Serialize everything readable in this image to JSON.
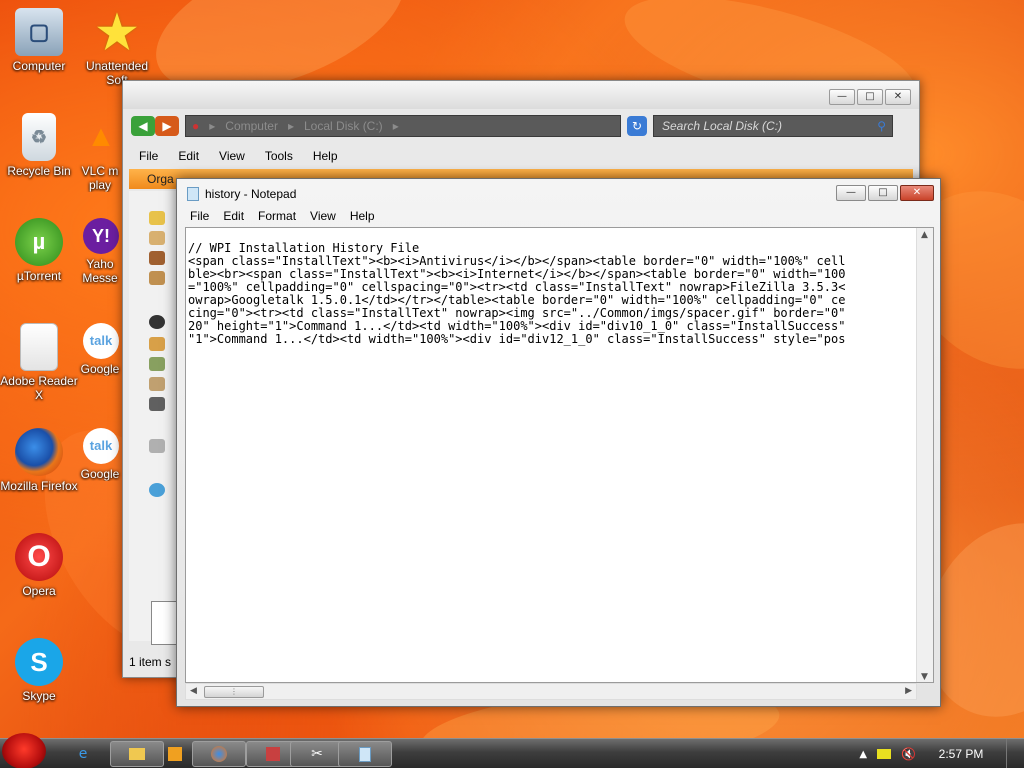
{
  "desktop": {
    "icons": [
      {
        "label": "Computer"
      },
      {
        "label": "Unattended Soft"
      },
      {
        "label": "Recycle Bin"
      },
      {
        "label": "VLC m play"
      },
      {
        "label": "µTorrent"
      },
      {
        "label": "Yaho Messe"
      },
      {
        "label": "Adobe Reader X"
      },
      {
        "label": "Google"
      },
      {
        "label": "Mozilla Firefox"
      },
      {
        "label": "Google"
      },
      {
        "label": "Opera"
      },
      {
        "label": "Skype"
      }
    ]
  },
  "explorer": {
    "address": [
      "Computer",
      "Local Disk (C:)"
    ],
    "search_placeholder": "Search Local Disk (C:)",
    "menu": [
      "File",
      "Edit",
      "View",
      "Tools",
      "Help"
    ],
    "org_label": "Orga",
    "status": "1 item s"
  },
  "notepad": {
    "title": "history - Notepad",
    "menu": [
      "File",
      "Edit",
      "Format",
      "View",
      "Help"
    ],
    "lines": [
      "// WPI Installation History File",
      "<span class=\"InstallText\"><b><i>Antivirus</i></b></span><table border=\"0\" width=\"100%\" cell",
      "ble><br><span class=\"InstallText\"><b><i>Internet</i></b></span><table border=\"0\" width=\"100",
      "=\"100%\" cellpadding=\"0\" cellspacing=\"0\"><tr><td class=\"InstallText\" nowrap>FileZilla 3.5.3<",
      "owrap>Googletalk 1.5.0.1</td></tr></table><table border=\"0\" width=\"100%\" cellpadding=\"0\" ce",
      "cing=\"0\"><tr><td class=\"InstallText\" nowrap><img src=\"../Common/imgs/spacer.gif\" border=\"0\"",
      "20\" height=\"1\">Command 1...</td><td width=\"100%\"><div id=\"div10_1_0\" class=\"InstallSuccess\"",
      "\"1\">Command 1...</td><td width=\"100%\"><div id=\"div12_1_0\" class=\"InstallSuccess\" style=\"pos"
    ]
  },
  "taskbar": {
    "clock": "2:57 PM"
  },
  "colors": {
    "wallpaper": "#e8440a",
    "taskbar": "#3e3e3e",
    "close_button": "#c9432a"
  }
}
